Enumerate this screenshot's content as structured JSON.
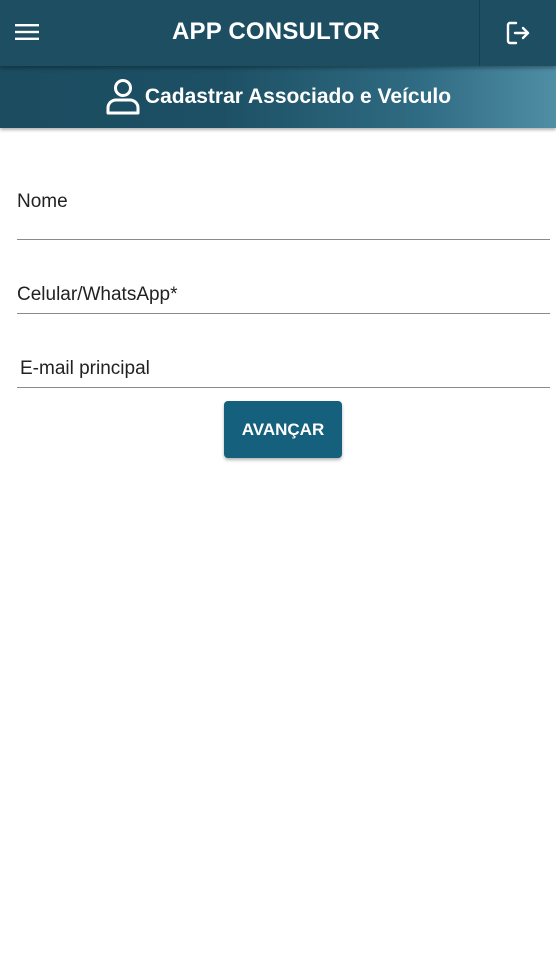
{
  "header": {
    "title": "APP CONSULTOR",
    "menu_icon": "hamburger-menu-icon",
    "logout_icon": "logout-icon",
    "background": "#1d4e62"
  },
  "subheader": {
    "title": "Cadastrar Associado e Veículo",
    "icon": "user-icon"
  },
  "form": {
    "name_placeholder": "Nome",
    "phone_placeholder": "Celular/WhatsApp*",
    "email_placeholder": "E-mail principal",
    "submit_label": "AVANÇAR",
    "accent": "#15607c"
  }
}
